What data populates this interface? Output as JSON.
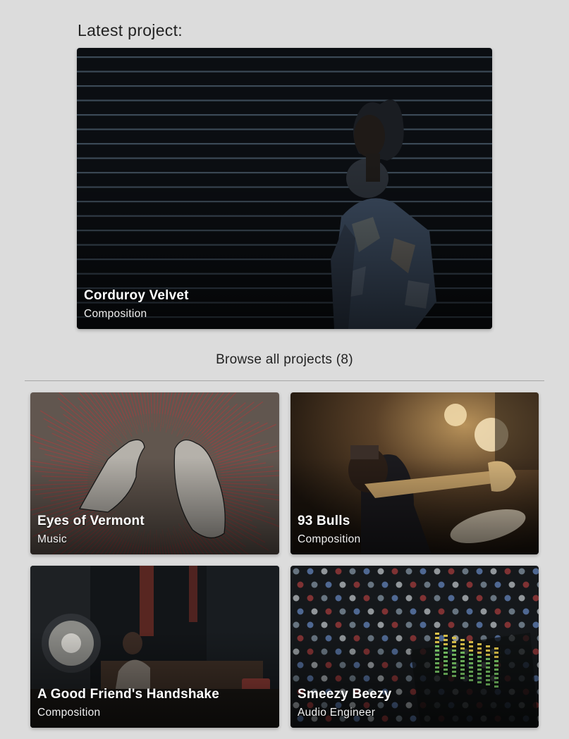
{
  "latest": {
    "heading": "Latest project:",
    "project": {
      "title": "Corduroy Velvet",
      "category": "Composition"
    }
  },
  "browse": {
    "label": "Browse all projects (8)"
  },
  "projects": [
    {
      "title": "Eyes of Vermont",
      "category": "Music"
    },
    {
      "title": "93 Bulls",
      "category": "Composition"
    },
    {
      "title": "A Good Friend's Handshake",
      "category": "Composition"
    },
    {
      "title": "Smeezy Beezy",
      "category": "Audio Engineer"
    }
  ],
  "colors": {
    "page_background": "#dcdcdc",
    "text_dark": "#222222",
    "card_text": "#ffffff",
    "divider": "#a6a6a6"
  }
}
